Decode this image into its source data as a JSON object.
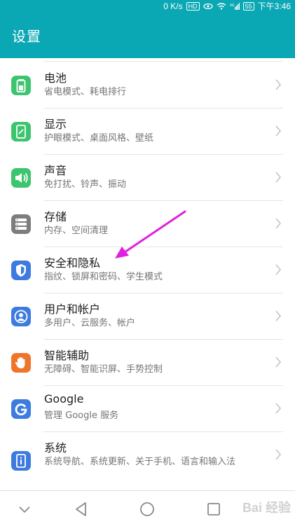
{
  "status_bar": {
    "speed": "0 K/s",
    "hd_badge": "HD",
    "network": "4G",
    "battery": "55",
    "time": "下午3:46"
  },
  "header": {
    "title": "设置"
  },
  "accent_color": "#0aa7b4",
  "settings": [
    {
      "title": "电池",
      "subtitle": "省电模式、耗电排行",
      "icon": "battery-icon",
      "color": "#3dc46e"
    },
    {
      "title": "显示",
      "subtitle": "护眼模式、桌面风格、壁纸",
      "icon": "display-icon",
      "color": "#3dc46e"
    },
    {
      "title": "声音",
      "subtitle": "免打扰、铃声、振动",
      "icon": "sound-icon",
      "color": "#3dc46e"
    },
    {
      "title": "存储",
      "subtitle": "内存、空间清理",
      "icon": "storage-icon",
      "color": "#7d7d7d"
    },
    {
      "title": "安全和隐私",
      "subtitle": "指纹、锁屏和密码、学生模式",
      "icon": "shield-icon",
      "color": "#3d7be0"
    },
    {
      "title": "用户和帐户",
      "subtitle": "多用户、云服务、帐户",
      "icon": "user-icon",
      "color": "#3d7be0"
    },
    {
      "title": "智能辅助",
      "subtitle": "无障碍、智能识屏、手势控制",
      "icon": "hand-icon",
      "color": "#f0742c"
    },
    {
      "title": "Google",
      "subtitle": "管理 Google 服务",
      "icon": "google-icon",
      "color": "#3d7be0"
    },
    {
      "title": "系统",
      "subtitle": "系统导航、系统更新、关于手机、语言和输入法",
      "icon": "system-info-icon",
      "color": "#3d7be0"
    }
  ],
  "annotation": {
    "color": "#e020e0",
    "icon": "arrow-pointer-icon"
  },
  "navbar": {
    "icons": [
      "collapse-icon",
      "back-icon",
      "home-icon",
      "recents-icon"
    ]
  },
  "watermark": "Bai 经验"
}
